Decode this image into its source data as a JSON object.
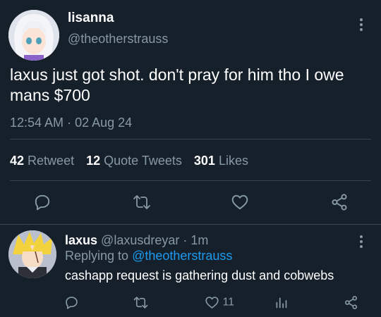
{
  "tweet": {
    "author_name": "lisanna",
    "author_handle": "@theotherstrauss",
    "text": "laxus just got shot. don't pray for him tho I owe mans $700",
    "time": "12:54 AM",
    "dot": "·",
    "date": "02 Aug 24",
    "stats": {
      "retweets_count": "42",
      "retweets_label": "Retweet",
      "quotes_count": "12",
      "quotes_label": "Quote Tweets",
      "likes_count": "301",
      "likes_label": "Likes"
    },
    "actions": [
      "reply-icon",
      "retweet-icon",
      "like-icon",
      "share-icon"
    ]
  },
  "reply": {
    "author_name": "laxus",
    "author_handle": "@laxusdreyar",
    "dot": "·",
    "age": "1m",
    "replying_prefix": "Replying to",
    "replying_handle": "@theotherstrauss",
    "text": "cashapp request is gathering dust and cobwebs",
    "like_count": "11",
    "actions": [
      "reply-icon",
      "retweet-icon",
      "like-icon",
      "analytics-icon",
      "share-icon"
    ]
  },
  "colors": {
    "background": "#15202b",
    "text": "#ffffff",
    "muted": "#8899a6",
    "link": "#1d9bf0",
    "divider": "#38444d"
  }
}
